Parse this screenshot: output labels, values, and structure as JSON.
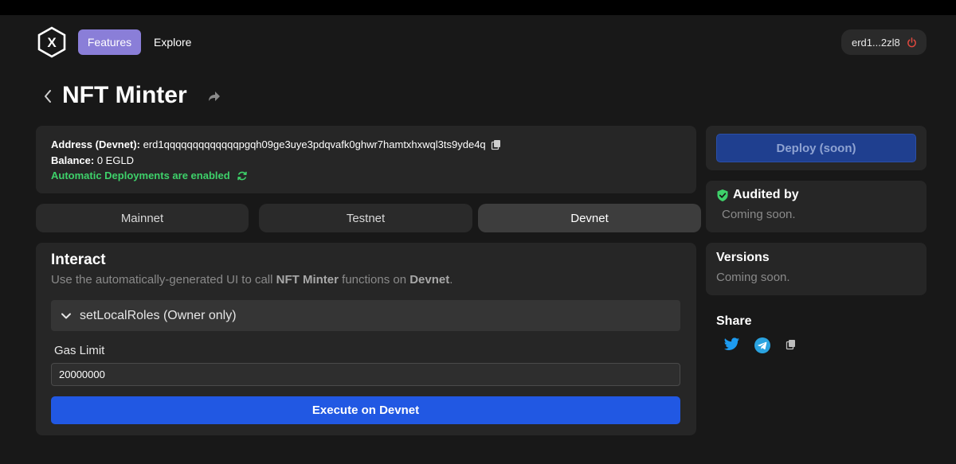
{
  "nav": {
    "features_label": "Features",
    "explore_label": "Explore",
    "wallet_label": "erd1...2zl8"
  },
  "page": {
    "title": "NFT Minter"
  },
  "info": {
    "address_label": "Address (Devnet):",
    "address_value": "erd1qqqqqqqqqqqqqpgqh09ge3uye3pdqvafk0ghwr7hamtxhxwql3ts9yde4q",
    "balance_label": "Balance:",
    "balance_value": "0 EGLD",
    "auto_deploy": "Automatic Deployments are enabled"
  },
  "tabs": [
    {
      "label": "Mainnet",
      "active": false
    },
    {
      "label": "Testnet",
      "active": false
    },
    {
      "label": "Devnet",
      "active": true
    }
  ],
  "interact": {
    "title": "Interact",
    "subtitle_pre": "Use the automatically-generated UI to call ",
    "subtitle_contract": "NFT Minter",
    "subtitle_mid": " functions on ",
    "subtitle_network": "Devnet",
    "subtitle_post": ".",
    "function_label": "setLocalRoles (Owner only)",
    "gas_label": "Gas Limit",
    "gas_value": "20000000",
    "execute_label": "Execute on Devnet"
  },
  "side": {
    "deploy_label": "Deploy (soon)",
    "audited_title": "Audited by",
    "audited_sub": "Coming soon.",
    "versions_title": "Versions",
    "versions_sub": "Coming soon.",
    "share_title": "Share"
  },
  "colors": {
    "background": "#181818",
    "card": "#262626",
    "accent_purple": "#8a7ed8",
    "primary_blue": "#2158e3",
    "success_green": "#3ed16a",
    "power_red": "#e0483e"
  },
  "icons": [
    "multiversx-logo-icon",
    "power-icon",
    "chevron-left-icon",
    "share-arrow-icon",
    "copy-icon",
    "refresh-icon",
    "chevron-down-icon",
    "shield-check-icon",
    "twitter-icon",
    "telegram-icon"
  ]
}
